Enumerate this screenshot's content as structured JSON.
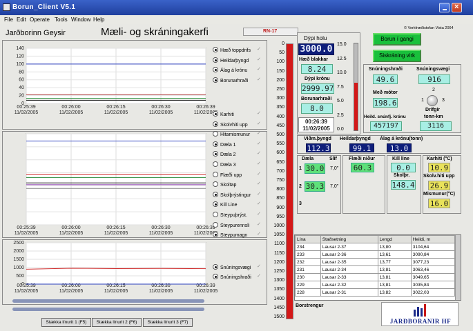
{
  "window": {
    "title": "Borun_Client V5.1"
  },
  "menu": [
    "File",
    "Edit",
    "Operate",
    "Tools",
    "Window",
    "Help"
  ],
  "header": {
    "site": "Jarðborinn Geysir",
    "title": "Mæli- og skráningakerfi",
    "well": "RN-17",
    "copyright": "© Verkfræðistofan Vista 2004"
  },
  "chart_data": [
    {
      "type": "line",
      "ylim": [
        0,
        140
      ],
      "yticks": [
        "140",
        "120",
        "100",
        "80",
        "60",
        "40",
        "20",
        "0"
      ],
      "x": [
        "00:25:39 11/02/2005",
        "00:26:00 11/02/2005",
        "00:26:15 11/02/2005",
        "00:26:30 11/02/2005",
        "00:26:39 11/02/2005"
      ],
      "series": [
        {
          "name": "Hæð toppdrifs",
          "color": "#2b3fbf",
          "values": [
            100,
            100,
            100,
            100,
            100
          ]
        },
        {
          "name": "Heildarþyngd",
          "color": "#b04040",
          "values": [
            22,
            22,
            22,
            22,
            22
          ]
        },
        {
          "name": "Álag á krónu",
          "color": "#2a8a3a",
          "values": [
            13,
            13,
            13,
            13,
            13
          ]
        },
        {
          "name": "Borunarhraði",
          "color": "#111111",
          "values": [
            8,
            8,
            8,
            8,
            8
          ]
        }
      ]
    },
    {
      "type": "line",
      "yticks": [],
      "x": [
        "00:25:39 11/02/2005",
        "00:26:00 11/02/2005",
        "00:26:15 11/02/2005",
        "00:26:30 11/02/2005",
        "00:26:39 11/02/2005"
      ],
      "series": [
        {
          "name": "Karhiti",
          "color": "#2b3fbf",
          "values": [
            0.92,
            0.92,
            0.92,
            0.92,
            0.92
          ]
        },
        {
          "name": "Skolvhiti upp",
          "color": "#d03030",
          "values": [
            0.55,
            0.55,
            0.55,
            0.55,
            0.55
          ]
        },
        {
          "name": "Hitamismunur",
          "color": "#2a8a3a",
          "values": [
            0.52,
            0.52,
            0.52,
            0.52,
            0.52
          ]
        },
        {
          "name": "Dæla 1",
          "color": "#111111",
          "values": [
            0.46,
            0.46,
            0.46,
            0.46,
            0.46
          ]
        },
        {
          "name": "Dæla 2",
          "color": "#8a3ab0",
          "values": [
            0.44,
            0.44,
            0.44,
            0.44,
            0.44
          ]
        },
        {
          "name": "Dæla 3",
          "color": "#888888",
          "values": [
            0.4,
            0.4,
            0.4,
            0.4,
            0.4
          ]
        }
      ]
    },
    {
      "type": "line",
      "ylim": [
        0,
        2500
      ],
      "yticks": [
        "2500",
        "2000",
        "1500",
        "1000",
        "500",
        "0"
      ],
      "x": [
        "00:25:39 11/02/2005",
        "00:26:00 11/02/2005",
        "00:26:15 11/02/2005",
        "00:26:30 11/02/2005",
        "00:26:39 11/02/2005"
      ],
      "series": [
        {
          "name": "Snúningsvægi",
          "color": "#d03030",
          "values": [
            900,
            960,
            940,
            950,
            930
          ]
        },
        {
          "name": "Snúningshraði",
          "color": "#2b3fbf",
          "values": [
            0,
            0,
            0,
            0,
            0
          ]
        }
      ]
    }
  ],
  "legend1": [
    {
      "label": "Hæð toppdrifs",
      "on": true
    },
    {
      "label": "Heildarþyngd",
      "on": true
    },
    {
      "label": "Álag á krónu",
      "on": true
    },
    {
      "label": "Borunarhraði",
      "on": true
    }
  ],
  "legend2": [
    {
      "label": "Karhiti",
      "on": true
    },
    {
      "label": "Skolvhiti upp",
      "on": true
    },
    {
      "label": "Hitamismunur",
      "on": false
    },
    {
      "label": "Dæla 1",
      "on": true
    },
    {
      "label": "Dæla 2",
      "on": true
    },
    {
      "label": "Dæla 3",
      "on": false
    },
    {
      "label": "Flæði upp",
      "on": false
    },
    {
      "label": "Skoltap",
      "on": false
    },
    {
      "label": "Skolþrýstingur",
      "on": true
    },
    {
      "label": "Kill Line",
      "on": true
    },
    {
      "label": "Steypuþrýst.",
      "on": false
    },
    {
      "label": "Steypurennsli",
      "on": false
    },
    {
      "label": "Steypumagn",
      "on": true
    }
  ],
  "legend3": [
    {
      "label": "Snúningsvægi",
      "on": true
    },
    {
      "label": "Snúningshraði",
      "on": true
    }
  ],
  "depth_meter": {
    "ticks": [
      "0",
      "50",
      "100",
      "150",
      "200",
      "250",
      "300",
      "350",
      "400",
      "450",
      "500",
      "550",
      "600",
      "650",
      "700",
      "750",
      "800",
      "850",
      "900",
      "950",
      "1000",
      "1050",
      "1100",
      "1150",
      "1200",
      "1250",
      "1300",
      "1350",
      "1400",
      "1450",
      "1500"
    ],
    "max": 1500,
    "value": 3000
  },
  "left_panel": {
    "dypi_holu_label": "Dýpi holu",
    "dypi_holu": "3000.0",
    "haed_blakkar_label": "Hæð blakkar",
    "haed_blakkar": "8.24",
    "dypi_kronu_label": "Dýpi krónu",
    "dypi_kronu": "2999.97",
    "borunarhradi_label": "Borunarhraði",
    "borunarhradi": "8.0",
    "time": "00:26:39",
    "date": "11/02/2005",
    "mini_scale": [
      "15.0",
      "12.5",
      "10.0",
      "7.5",
      "5.0",
      "2.5",
      "0.0"
    ]
  },
  "buttons": {
    "borun": "Borun í gangi",
    "sisk": "Siskráning virk"
  },
  "rotation": {
    "snhradi_label": "Snúningshraði",
    "snhradi": "49.6",
    "snvaegi_label": "Snúningsvægi",
    "snvaegi": "916",
    "medmotor_label": "Með mótor",
    "medmotor": "198.6",
    "drifgir_label": "Drifgír",
    "drif_1": "1",
    "drif_2": "2",
    "drif_3": "3",
    "heild_label": "Heild. snúnfj. krónu",
    "heild": "457197",
    "tonnkm_label": "tonn-km",
    "tonnkm": "3116"
  },
  "weights": {
    "vidm_label": "Viðm.þyngd",
    "vidm": "112.3",
    "heildar_label": "Heildarþyngd",
    "heildar": "99.1",
    "alag_label": "Álag á krónu(tonn)",
    "alag": "13.0"
  },
  "pumps": {
    "daela_label": "Dæla",
    "slif_label": "Slif",
    "p1_label": "1",
    "p1": "30.0",
    "p1_slif": "7,0\"",
    "p2_label": "2",
    "p2": "30.3",
    "p2_slif": "7,0\"",
    "p3_label": "3",
    "flaedi_label": "Flæði niður",
    "flaedi": "60.3",
    "kill_label": "Kill line",
    "kill": "0.0",
    "skolpr_label": "Skolþr.",
    "skolpr": "148.4",
    "karhiti_label": "Karhiti (°C)",
    "karhiti": "10.9",
    "skolv_label": "Skolv.hiti upp",
    "skolv": "26.9",
    "mism_label": "Mismunur(°C)",
    "mism": "16.0"
  },
  "table": {
    "headers": [
      "Lína",
      "Staðsetning",
      "Lengd",
      "Heildi, m"
    ],
    "rows": [
      [
        "234",
        "Lausar 2-37",
        "13,80",
        "3104,64"
      ],
      [
        "233",
        "Lausar 2-36",
        "13,61",
        "3090,84"
      ],
      [
        "232",
        "Lausar 2-35",
        "13,77",
        "3077,23"
      ],
      [
        "231",
        "Lausar 2-34",
        "13,81",
        "3063,46"
      ],
      [
        "230",
        "Lausar 2-33",
        "13,81",
        "3049,65"
      ],
      [
        "229",
        "Lausar 2-32",
        "13,81",
        "3035,84"
      ],
      [
        "228",
        "Lausar 2-31",
        "13,82",
        "3022,03"
      ]
    ],
    "borstrengur_label": "Borstrengur"
  },
  "logo": {
    "text": "JARÐBORANIR HF"
  },
  "bottom_buttons": [
    "Stækka línurit 1 (F5)",
    "Stækka línurit 2 (F6)",
    "Stækka línurit 3 (F7)"
  ]
}
